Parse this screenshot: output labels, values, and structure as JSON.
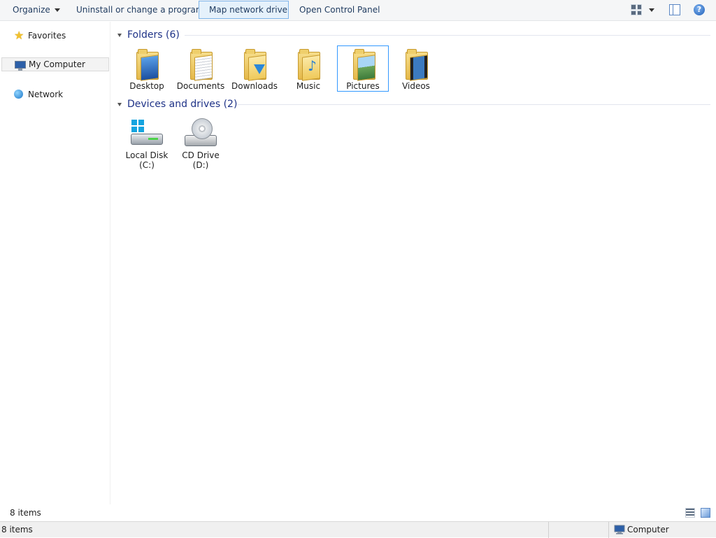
{
  "toolbar": {
    "organize_label": "Organize",
    "uninstall_label": "Uninstall or change a program",
    "map_drive_label": "Map network drive",
    "control_panel_label": "Open Control Panel",
    "help_glyph": "?"
  },
  "nav": {
    "favorites_label": "Favorites",
    "my_computer_label": "My Computer",
    "network_label": "Network"
  },
  "groups": {
    "folders_header": "Folders (6)",
    "devices_header": "Devices and drives (2)"
  },
  "folders": [
    {
      "label": "Desktop",
      "icon": "desktop-folder-icon"
    },
    {
      "label": "Documents",
      "icon": "documents-folder-icon"
    },
    {
      "label": "Downloads",
      "icon": "downloads-folder-icon"
    },
    {
      "label": "Music",
      "icon": "music-folder-icon"
    },
    {
      "label": "Pictures",
      "icon": "pictures-folder-icon"
    },
    {
      "label": "Videos",
      "icon": "videos-folder-icon"
    }
  ],
  "drives": [
    {
      "label_line1": "Local Disk",
      "label_line2": "(C:)",
      "icon": "hard-disk-icon"
    },
    {
      "label_line1": "CD Drive",
      "label_line2": "(D:)",
      "icon": "cd-drive-icon"
    }
  ],
  "status": {
    "item_count": "8 items",
    "bottom_item_count": "8 items",
    "location": "Computer"
  },
  "colors": {
    "accent_blue": "#1e3287",
    "selection_border": "#3399ff",
    "folder_yellow": "#efc95a"
  }
}
